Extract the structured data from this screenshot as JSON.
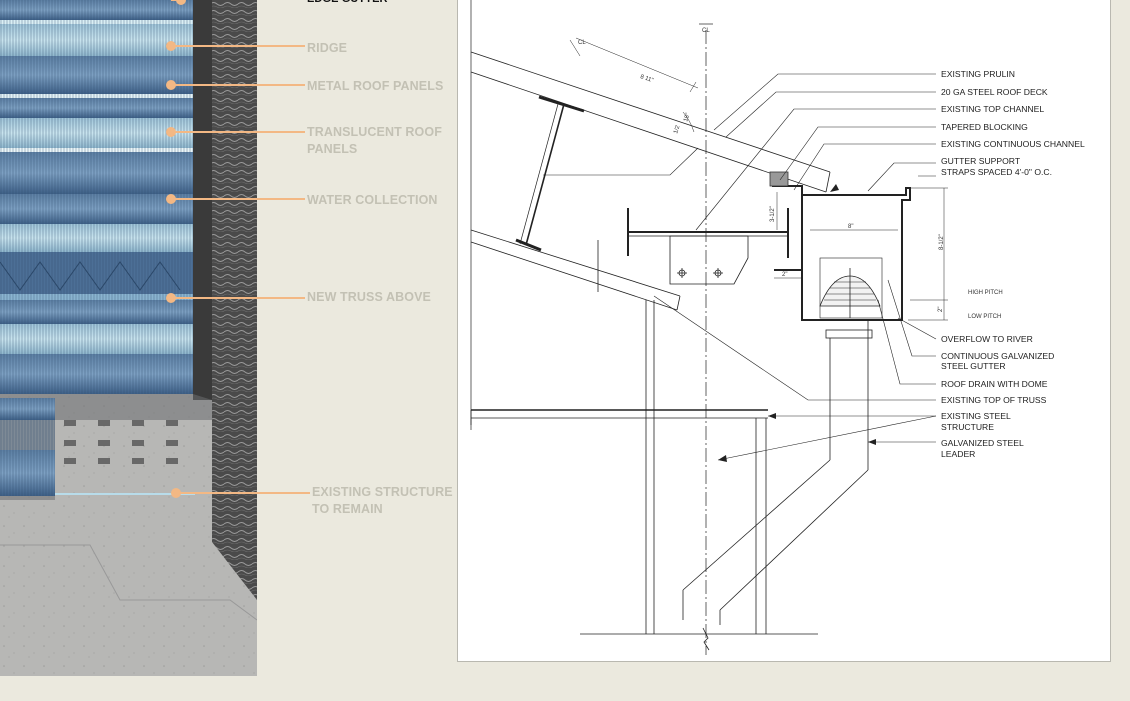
{
  "plan": {
    "title_partial": "EDGE GUTTER",
    "callouts": [
      {
        "id": "ridge",
        "label": "RIDGE"
      },
      {
        "id": "metal",
        "label": "METAL  ROOF PANELS"
      },
      {
        "id": "translucent",
        "line1": "TRANSLUCENT ROOF",
        "line2": "PANELS"
      },
      {
        "id": "water",
        "label": "WATER COLLECTION"
      },
      {
        "id": "truss",
        "label": "NEW TRUSS ABOVE"
      },
      {
        "id": "existing",
        "line1": "EXISTING STRUCTURE",
        "line2": "TO REMAIN"
      }
    ],
    "callout_color": "#f3b884",
    "label_color": "#c3c1b4"
  },
  "detail": {
    "labels": {
      "purlin": "EXISTING PRULIN",
      "deck": "20 GA STEEL ROOF DECK",
      "top_channel": "EXISTING TOP CHANNEL",
      "blocking": "TAPERED BLOCKING",
      "cont_channel": "EXISTING CONTINUOUS CHANNEL",
      "gutter_support_1": "GUTTER SUPPORT",
      "gutter_support_2": "STRAPS SPACED 4'-0\" O.C.",
      "overflow": "OVERFLOW TO RIVER",
      "galv_gutter_1": "CONTINUOUS GALVANIZED",
      "galv_gutter_2": "STEEL GUTTER",
      "drain": "ROOF DRAIN WITH DOME",
      "truss_top": "EXISTING TOP OF TRUSS",
      "steel_1": "EXISTING STEEL",
      "steel_2": "STRUCTURE",
      "leader_1": "GALVANIZED STEEL",
      "leader_2": "LEADER"
    },
    "dims": {
      "high_pitch": "HIGH PITCH",
      "low_pitch": "LOW PITCH",
      "d_811": "8 11\"",
      "d_18": "18\"",
      "d_half": "1/2",
      "d_8": "8\"",
      "d_812": "8-1/2\"",
      "d_2a": "2\"",
      "d_2b": "2\"",
      "d_3half": "3-1/2\""
    },
    "centerline": "CL"
  }
}
